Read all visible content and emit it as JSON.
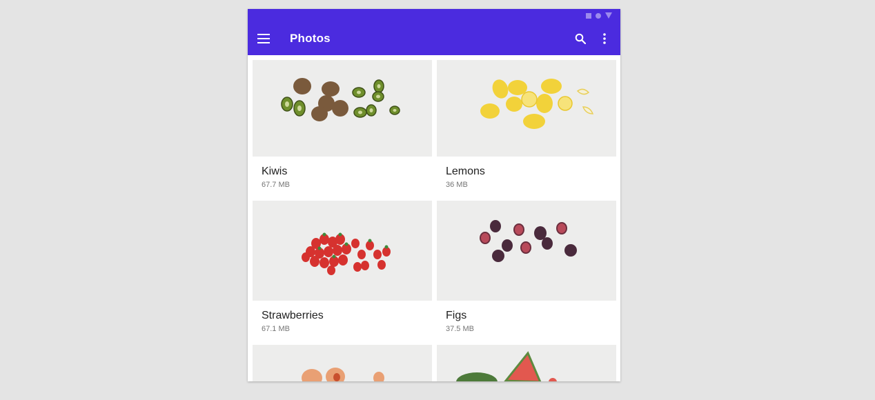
{
  "app": {
    "title": "Photos",
    "accent_color": "#4b2bdf"
  },
  "status_icons": [
    "square-icon",
    "circle-icon",
    "signal-triangle-icon"
  ],
  "toolbar": {
    "menu_icon": "menu-icon",
    "search_icon": "search-icon",
    "more_icon": "more-vert-icon"
  },
  "cards": [
    {
      "title": "Kiwis",
      "size": "67.7 MB",
      "image": "kiwis-photo"
    },
    {
      "title": "Lemons",
      "size": "36 MB",
      "image": "lemons-photo"
    },
    {
      "title": "Strawberries",
      "size": "67.1 MB",
      "image": "strawberries-photo"
    },
    {
      "title": "Figs",
      "size": "37.5 MB",
      "image": "figs-photo"
    },
    {
      "title": "",
      "size": "",
      "image": "peaches-photo"
    },
    {
      "title": "",
      "size": "",
      "image": "watermelon-photo"
    }
  ]
}
